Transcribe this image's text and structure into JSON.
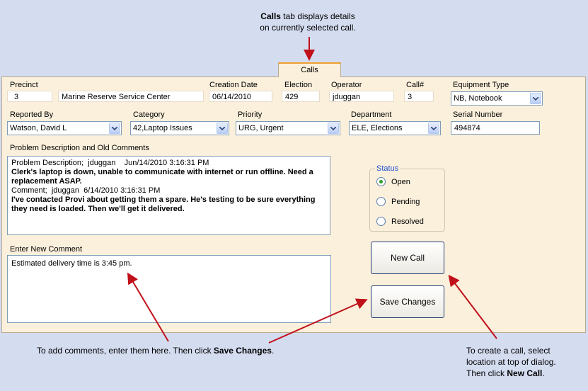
{
  "annotations": {
    "top_bold": "Calls",
    "top_rest": " tab displays details",
    "top_line2": "on currently selected call.",
    "comment_pre": "To add comments, enter them here. Then click ",
    "comment_bold": "Save Changes",
    "comment_post": ".",
    "create_line1": "To create a call, select",
    "create_line2": "location at top of dialog.",
    "create_pre": "Then click ",
    "create_bold": "New Call",
    "create_post": "."
  },
  "tab": {
    "label": "Calls"
  },
  "fields": {
    "precinct": {
      "label": "Precinct",
      "value": "3"
    },
    "precinct_name": {
      "value": "Marine Reserve Service Center"
    },
    "creation_date": {
      "label": "Creation Date",
      "value": "06/14/2010"
    },
    "election": {
      "label": "Election",
      "value": "429"
    },
    "operator": {
      "label": "Operator",
      "value": "jduggan"
    },
    "call_no": {
      "label": "Call#",
      "value": "3"
    },
    "equipment_type": {
      "label": "Equipment Type",
      "value": "NB, Notebook"
    },
    "reported_by": {
      "label": "Reported By",
      "value": "Watson, David L"
    },
    "category": {
      "label": "Category",
      "value": "42,Laptop Issues"
    },
    "priority": {
      "label": "Priority",
      "value": "URG, Urgent"
    },
    "department": {
      "label": "Department",
      "value": "ELE, Elections"
    },
    "serial_number": {
      "label": "Serial Number",
      "value": "494874"
    }
  },
  "problem": {
    "label": "Problem Description and Old Comments",
    "entries": [
      {
        "head": "Problem Description;  jduggan    Jun/14/2010 3:16:31 PM",
        "body": "Clerk's laptop is down, unable to communicate with internet or run offline. Need a replacement ASAP."
      },
      {
        "head": "Comment;  jduggan  6/14/2010 3:16:31 PM",
        "body": "I've contacted Provi about getting them a spare. He's testing to be sure everything they need is loaded. Then we'll get it delivered."
      }
    ]
  },
  "new_comment": {
    "label": "Enter New Comment",
    "value": "Estimated delivery time is 3:45 pm."
  },
  "status": {
    "title": "Status",
    "options": [
      {
        "label": "Open",
        "selected": true
      },
      {
        "label": "Pending",
        "selected": false
      },
      {
        "label": "Resolved",
        "selected": false
      }
    ]
  },
  "buttons": {
    "new_call": "New Call",
    "save_changes": "Save Changes"
  },
  "colors": {
    "background": "#d4dcf0",
    "panel": "#fbf0dc",
    "arrow": "#c0101a",
    "tab_accent": "#f0a030",
    "status_title": "#1c4fd0",
    "radio_selected": "#2e9c2e"
  }
}
